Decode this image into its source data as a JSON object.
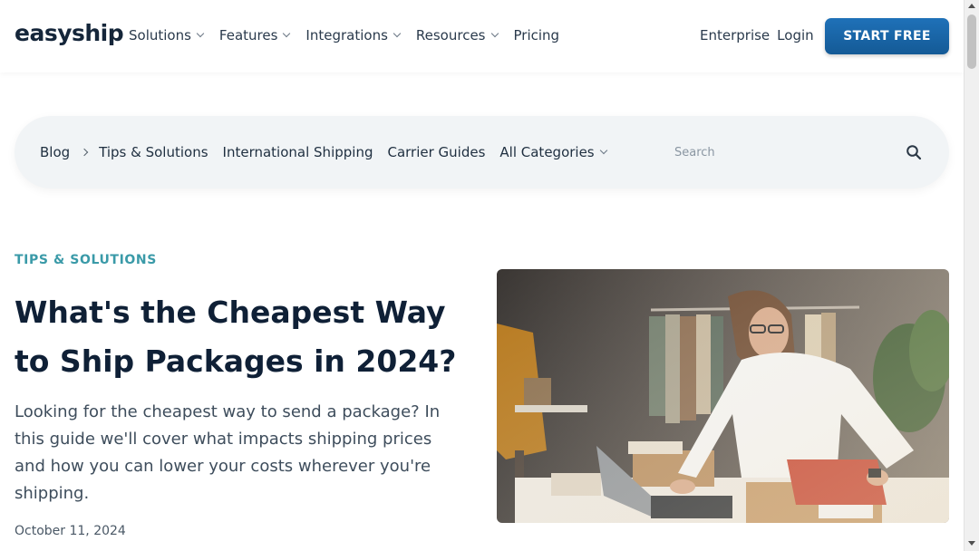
{
  "brand": {
    "logo_text": "easyship"
  },
  "nav": {
    "items": [
      {
        "label": "Solutions",
        "has_dropdown": true
      },
      {
        "label": "Features",
        "has_dropdown": true
      },
      {
        "label": "Integrations",
        "has_dropdown": true
      },
      {
        "label": "Resources",
        "has_dropdown": true
      },
      {
        "label": "Pricing",
        "has_dropdown": false
      }
    ],
    "enterprise": "Enterprise",
    "login": "Login",
    "cta": "START FREE"
  },
  "blogbar": {
    "root": "Blog",
    "links": [
      "Tips & Solutions",
      "International Shipping",
      "Carrier Guides",
      "All Categories"
    ],
    "search_placeholder": "Search"
  },
  "article": {
    "category": "TIPS & SOLUTIONS",
    "title": "What's the Cheapest Way to Ship Packages in 2024?",
    "lead": "Looking for the cheapest way to send a package? In this guide we'll cover what impacts shipping prices and how you can lower your costs wherever you're shipping.",
    "date": "October 11, 2024"
  },
  "colors": {
    "brand_blue": "#1a65a6",
    "accent_teal": "#3a9aa8",
    "text_dark": "#0f2036"
  },
  "icons": [
    "chevron-down-icon",
    "chevron-right-icon",
    "search-icon"
  ]
}
